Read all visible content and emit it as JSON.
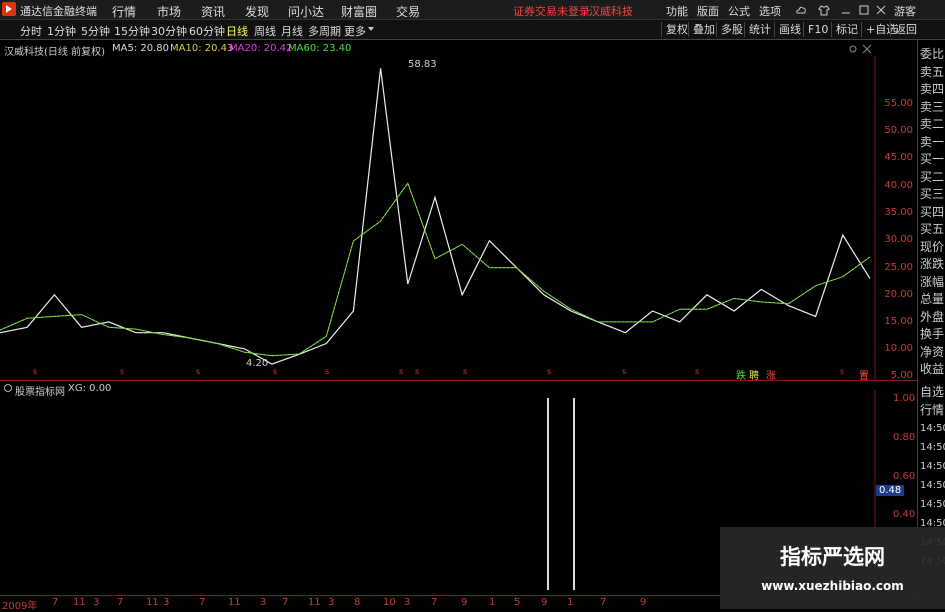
{
  "titlebar": {
    "app_title": "通达信金融终端",
    "menus": [
      "行情",
      "市场",
      "资讯",
      "发现",
      "问小达",
      "财富圈",
      "交易"
    ],
    "alert": "证券交易未登录",
    "stock": "汉威科技",
    "right_menus": [
      "功能",
      "版面",
      "公式",
      "选项"
    ],
    "guest": "游客"
  },
  "toolbar": {
    "periods": [
      "分时",
      "1分钟",
      "5分钟",
      "15分钟",
      "30分钟",
      "60分钟",
      "日线",
      "周线",
      "月线",
      "多周期",
      "更多"
    ],
    "active_period": "日线",
    "buttons": [
      "复权",
      "叠加",
      "多股",
      "统计",
      "画线",
      "F10",
      "标记",
      "+自选",
      "返回"
    ]
  },
  "main_chart": {
    "stock_label": "汉威科技(日线 前复权)",
    "ma5": "MA5: 20.80",
    "ma10": "MA10: 20.43",
    "ma20": "MA20: 20.42",
    "ma60": "MA60: 23.40",
    "high_label": "58.83",
    "low_label": "4.20",
    "y_ticks": [
      "55.00",
      "50.00",
      "45.00",
      "40.00",
      "35.00",
      "30.00",
      "25.00",
      "20.00",
      "15.00",
      "10.00",
      "5.00"
    ],
    "event_markers": [
      "跌",
      "聘",
      "涨",
      "置"
    ]
  },
  "sub_chart": {
    "indicator_label": "股票指标网",
    "xg": "XG: 0.00",
    "y_ticks": [
      "1.00",
      "0.80",
      "0.60",
      "0.40"
    ],
    "current": "0.48"
  },
  "x_axis": [
    "2009年",
    "7",
    "11",
    "3",
    "7",
    "11",
    "3",
    "7",
    "11",
    "3",
    "7",
    "11",
    "3",
    "8",
    "10",
    "3",
    "7",
    "9",
    "1",
    "5",
    "9",
    "1",
    "7",
    "9"
  ],
  "right_panel": {
    "top": [
      "委比",
      "卖五",
      "卖四",
      "卖三",
      "卖二",
      "卖一",
      "买一",
      "买二",
      "买三",
      "买四",
      "买五",
      "现价",
      "涨跌",
      "涨幅",
      "总量",
      "外盘",
      "换手",
      "净资",
      "收益"
    ],
    "bottom": [
      "自选",
      "行情"
    ],
    "times": [
      "14:50",
      "14:50",
      "14:50",
      "14:50",
      "14:50",
      "14:50",
      "14:50",
      "14:50"
    ]
  },
  "watermark": {
    "title": "指标严选网",
    "url": "www.xuezhibiao.com"
  },
  "chart_data": {
    "type": "line",
    "title": "汉威科技(日线 前复权)",
    "x": [
      "2009年",
      "7",
      "11",
      "3",
      "7",
      "11",
      "3",
      "7",
      "11",
      "3",
      "7",
      "11",
      "3",
      "8",
      "10",
      "3",
      "7",
      "9",
      "1",
      "5",
      "9",
      "1",
      "7",
      "9"
    ],
    "series": [
      {
        "name": "price",
        "values": [
          10,
          11,
          17,
          11,
          12,
          10,
          10,
          9,
          8,
          7,
          4.2,
          6,
          8,
          14,
          58.83,
          19,
          35,
          17,
          27,
          22,
          17,
          14,
          12,
          10,
          14,
          12,
          17,
          14,
          18,
          15,
          13,
          28,
          20
        ]
      }
    ],
    "ylim": [
      2,
      60
    ],
    "indicator": {
      "name": "XG",
      "spikes": [
        1.0,
        1.0
      ],
      "value": 0.0
    }
  }
}
